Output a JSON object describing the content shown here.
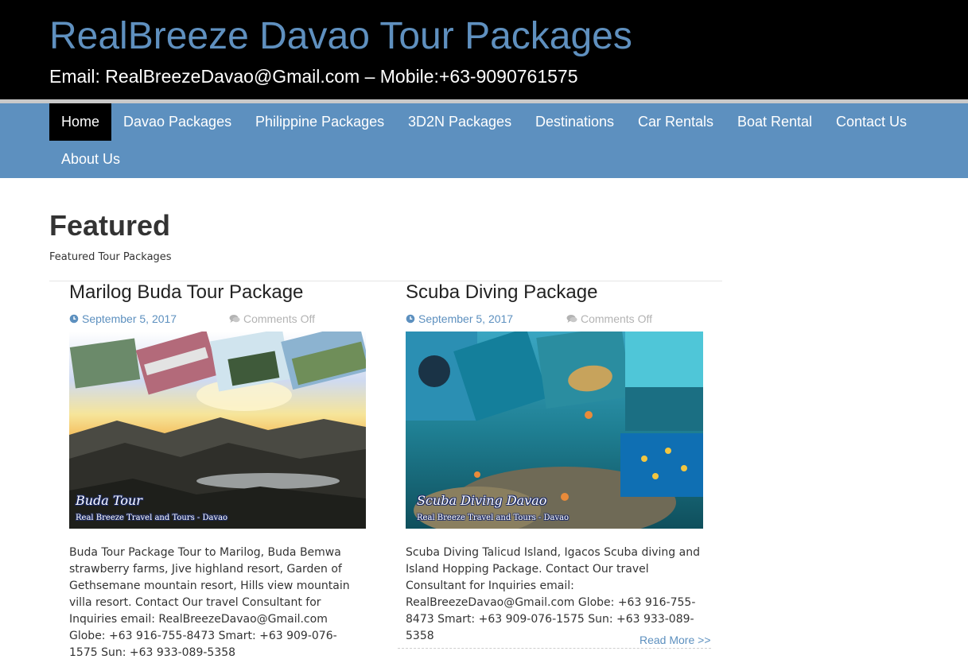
{
  "header": {
    "site_title": "RealBreeze Davao Tour Packages",
    "contact_line": "Email: RealBreezeDavao@Gmail.com – Mobile:+63-9090761575"
  },
  "nav": {
    "items": [
      {
        "label": "Home",
        "active": true
      },
      {
        "label": "Davao Packages"
      },
      {
        "label": "Philippine Packages"
      },
      {
        "label": "3D2N Packages"
      },
      {
        "label": "Destinations"
      },
      {
        "label": "Car Rentals"
      },
      {
        "label": "Boat Rental"
      },
      {
        "label": "Contact Us"
      },
      {
        "label": "About Us"
      }
    ]
  },
  "featured": {
    "title": "Featured",
    "subtitle": "Featured Tour Packages"
  },
  "posts": [
    {
      "title": "Marilog Buda Tour Package",
      "date": "September 5, 2017",
      "comments": "Comments Off",
      "image_caption": "Buda Tour",
      "image_subcaption": "Real Breeze Travel and Tours - Davao",
      "excerpt": "Buda Tour Package Tour to Marilog, Buda Bemwa strawberry farms, Jive highland resort, Garden of Gethsemane mountain resort, Hills view mountain villa resort.   Contact Our travel Consultant for Inquiries email: RealBreezeDavao@Gmail.com Globe: +63 916-755-8473 Smart: +63 909-076-1575 Sun: +63 933-089-5358"
    },
    {
      "title": "Scuba Diving Package",
      "date": "September 5, 2017",
      "comments": "Comments Off",
      "image_caption": "Scuba Diving Davao",
      "image_subcaption": "Real Breeze Travel and Tours - Davao",
      "excerpt": "Scuba Diving Talicud Island, Igacos Scuba diving and Island Hopping Package. Contact Our travel Consultant for Inquiries email: RealBreezeDavao@Gmail.com Globe: +63 916-755-8473 Smart: +63 909-076-1575 Sun: +63 933-089-5358",
      "read_more": "Read More >>"
    }
  ],
  "icons": {
    "date": "clock-icon",
    "comments": "comments-icon"
  },
  "colors": {
    "accent": "#5d90bf",
    "header_bg": "#000000",
    "nav_active_bg": "#000000"
  }
}
